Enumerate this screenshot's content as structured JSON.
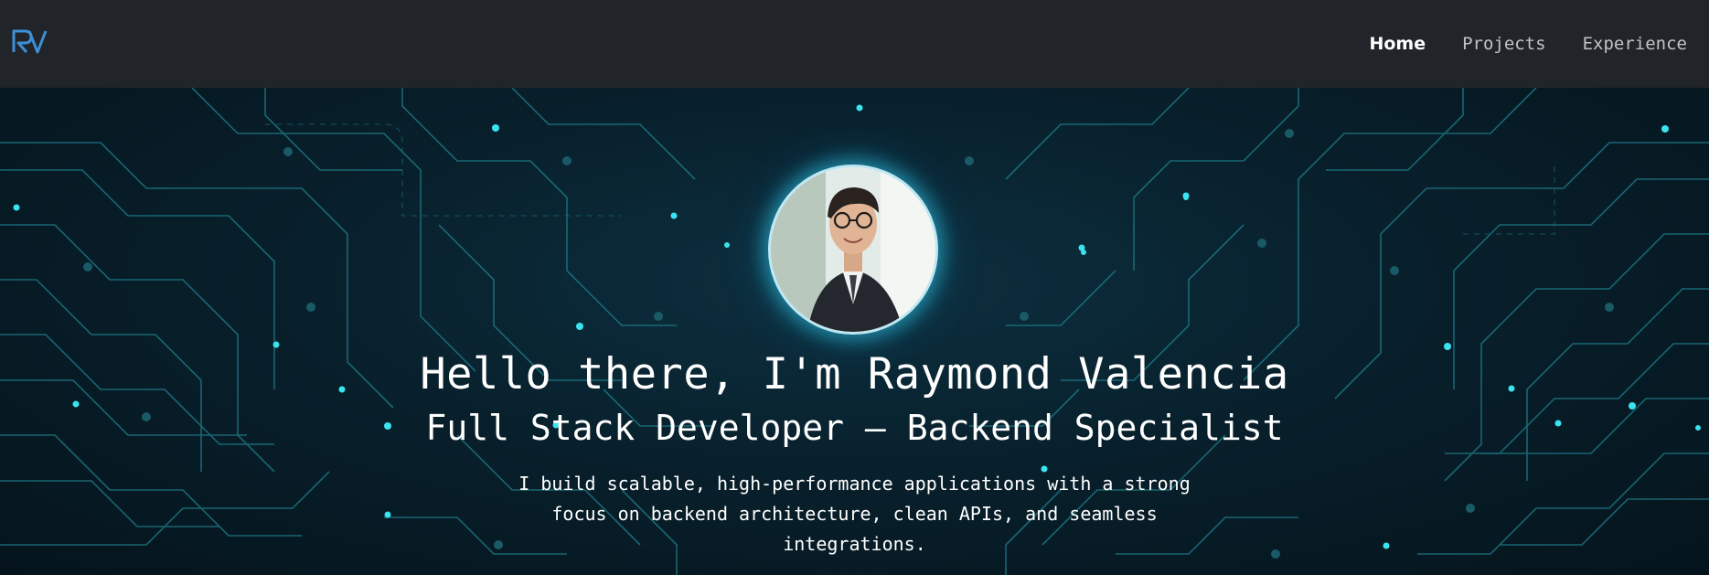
{
  "nav": {
    "logo_text": "RV",
    "links": [
      {
        "label": "Home",
        "active": true
      },
      {
        "label": "Projects",
        "active": false
      },
      {
        "label": "Experience",
        "active": false
      }
    ]
  },
  "hero": {
    "headline": "Hello there, I'm Raymond Valencia",
    "subtitle": "Full Stack Developer — Backend Specialist",
    "bio": "I build scalable, high-performance applications with a strong focus on backend architecture, clean APIs, and seamless integrations."
  },
  "colors": {
    "navbar": "#212529",
    "hero_bg": "#071a24",
    "circuit_line": "#1f7f8c",
    "circuit_dot": "#39e4f0",
    "logo_blue": "#3d8fd6"
  }
}
